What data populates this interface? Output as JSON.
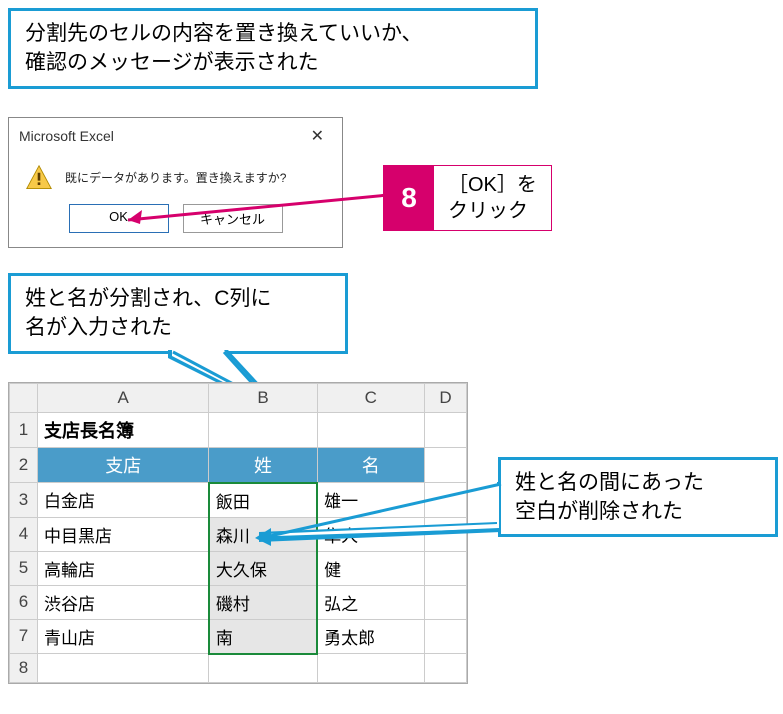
{
  "callouts": {
    "top": "分割先のセルの内容を置き換えていいか、\n確認のメッセージが表示された",
    "mid": "姓と名が分割され、C列に\n名が入力された",
    "right": "姓と名の間にあった\n空白が削除された"
  },
  "step": {
    "num": "8",
    "text": "［OK］を\nクリック"
  },
  "dialog": {
    "title": "Microsoft Excel",
    "message": "既にデータがあります。置き換えますか?",
    "ok": "OK",
    "cancel": "キャンセル"
  },
  "sheet": {
    "cols": [
      "A",
      "B",
      "C",
      "D"
    ],
    "title": "支店長名簿",
    "headers": {
      "a": "支店",
      "b": "姓",
      "c": "名"
    },
    "rows": [
      {
        "n": "3",
        "a": "白金店",
        "b": "飯田",
        "c": "雄一"
      },
      {
        "n": "4",
        "a": "中目黒店",
        "b": "森川",
        "c": "隼人"
      },
      {
        "n": "5",
        "a": "高輪店",
        "b": "大久保",
        "c": "健"
      },
      {
        "n": "6",
        "a": "渋谷店",
        "b": "磯村",
        "c": "弘之"
      },
      {
        "n": "7",
        "a": "青山店",
        "b": "南",
        "c": "勇太郎"
      }
    ]
  }
}
